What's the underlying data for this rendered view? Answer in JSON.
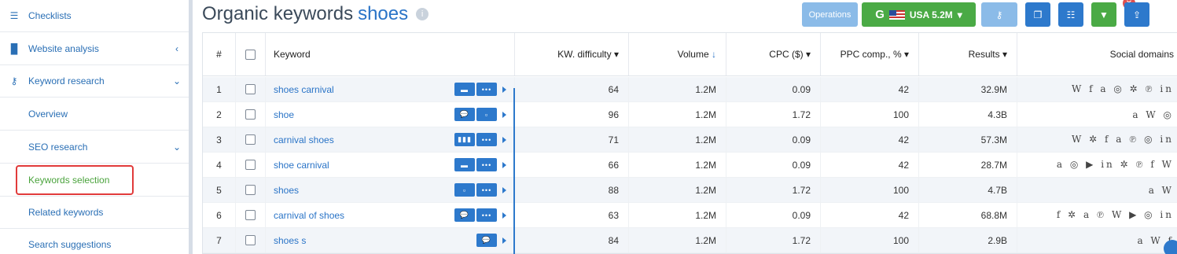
{
  "sidebar": {
    "items": [
      {
        "label": "Checklists",
        "icon": "list-icon"
      },
      {
        "label": "Website analysis",
        "icon": "chart-icon"
      },
      {
        "label": "Keyword research",
        "icon": "key-icon"
      },
      {
        "label": "Overview"
      },
      {
        "label": "SEO research"
      },
      {
        "label": "Keywords selection"
      },
      {
        "label": "Related keywords"
      },
      {
        "label": "Search suggestions"
      }
    ]
  },
  "header": {
    "title": "Organic keywords",
    "keyword": "shoes",
    "operations_label": "Operations",
    "db_label": "USA 5.2M"
  },
  "table": {
    "columns": [
      "#",
      "Keyword",
      "KW. difficulty",
      "Volume",
      "CPC ($)",
      "PPC comp., %",
      "Results",
      "Social domains"
    ],
    "rows": [
      {
        "num": "1",
        "keyword": "shoes carnival",
        "kd": "64",
        "volume": "1.2M",
        "cpc": "0.09",
        "ppc": "42",
        "results": "32.9M",
        "social": "W f a ◎ ✲ ℗ in"
      },
      {
        "num": "2",
        "keyword": "shoe",
        "kd": "96",
        "volume": "1.2M",
        "cpc": "1.72",
        "ppc": "100",
        "results": "4.3B",
        "social": "a W ◎"
      },
      {
        "num": "3",
        "keyword": "carnival shoes",
        "kd": "71",
        "volume": "1.2M",
        "cpc": "0.09",
        "ppc": "42",
        "results": "57.3M",
        "social": "W ✲ f a ℗ ◎ in"
      },
      {
        "num": "4",
        "keyword": "shoe carnival",
        "kd": "66",
        "volume": "1.2M",
        "cpc": "0.09",
        "ppc": "42",
        "results": "28.7M",
        "social": "a ◎ ▶ in ✲ ℗ f W"
      },
      {
        "num": "5",
        "keyword": "shoes",
        "kd": "88",
        "volume": "1.2M",
        "cpc": "1.72",
        "ppc": "100",
        "results": "4.7B",
        "social": "a W"
      },
      {
        "num": "6",
        "keyword": "carnival of shoes",
        "kd": "63",
        "volume": "1.2M",
        "cpc": "0.09",
        "ppc": "42",
        "results": "68.8M",
        "social": "f ✲ a ℗ W ▶ ◎ in"
      },
      {
        "num": "7",
        "keyword": "shoes s",
        "kd": "84",
        "volume": "1.2M",
        "cpc": "1.72",
        "ppc": "100",
        "results": "2.9B",
        "social": "a W f"
      }
    ]
  }
}
